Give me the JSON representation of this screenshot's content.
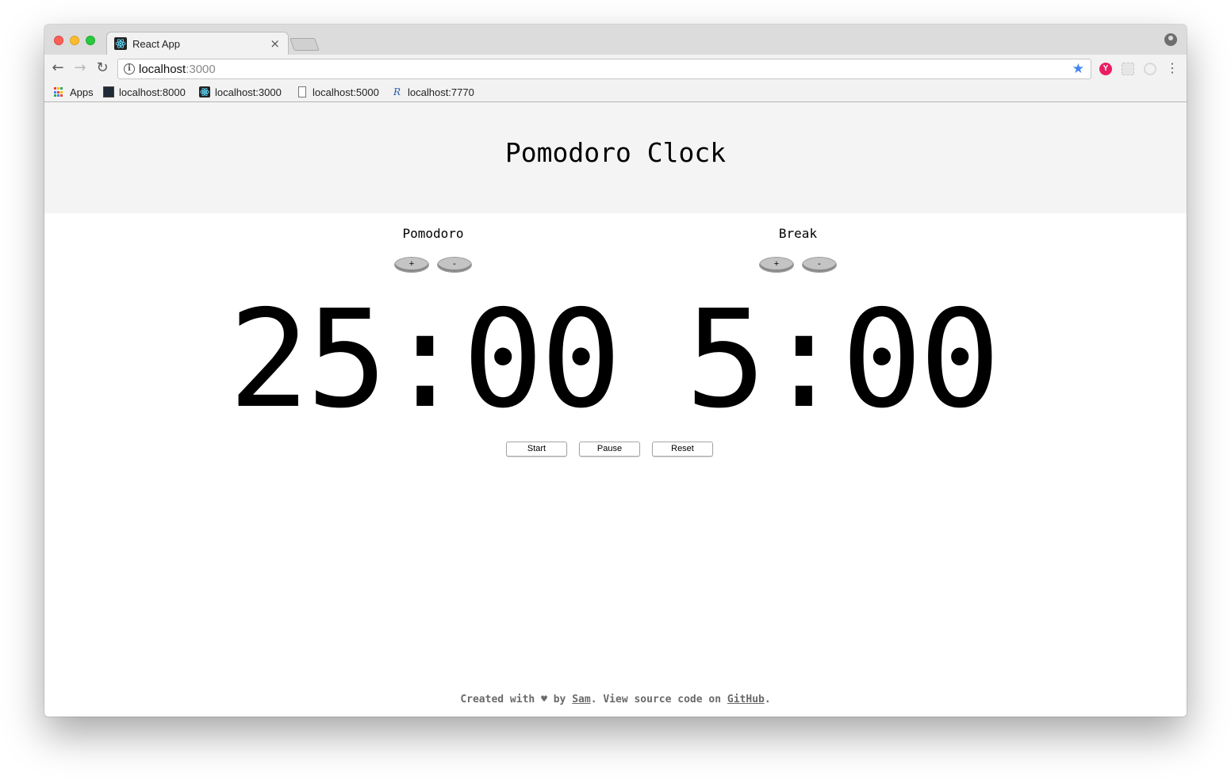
{
  "browser": {
    "tab": {
      "title": "React App",
      "close_glyph": "×",
      "favicon": "react-icon"
    },
    "nav": {
      "back_glyph": "←",
      "forward_glyph": "→",
      "reload_glyph": "↻",
      "menu_glyph": "⋮"
    },
    "omnibox": {
      "host": "localhost",
      "port": ":3000",
      "info_glyph": "i",
      "star_glyph": "★",
      "star_color": "#4285f4"
    },
    "extensions": {
      "first_glyph": "Y",
      "first_color": "#e91e63"
    },
    "bookmarks": [
      {
        "label": "Apps",
        "icon": "apps-grid-icon"
      },
      {
        "label": "localhost:8000",
        "icon": "terminal-icon"
      },
      {
        "label": "localhost:3000",
        "icon": "react-icon"
      },
      {
        "label": "localhost:5000",
        "icon": "file-icon"
      },
      {
        "label": "localhost:7770",
        "icon": "r-icon",
        "glyph": "R"
      }
    ]
  },
  "app": {
    "title": "Pomodoro Clock",
    "pomodoro": {
      "label": "Pomodoro",
      "plus": "+",
      "minus": "-",
      "time": "25:00"
    },
    "break": {
      "label": "Break",
      "plus": "+",
      "minus": "-",
      "time": "5:00"
    },
    "controls": {
      "start": "Start",
      "pause": "Pause",
      "reset": "Reset"
    },
    "footer": {
      "created_with": "Created with",
      "heart": "♥",
      "by": "by",
      "author": "Sam",
      "view_source": ". View source code on",
      "repo_link": "GitHub",
      "end": "."
    }
  }
}
